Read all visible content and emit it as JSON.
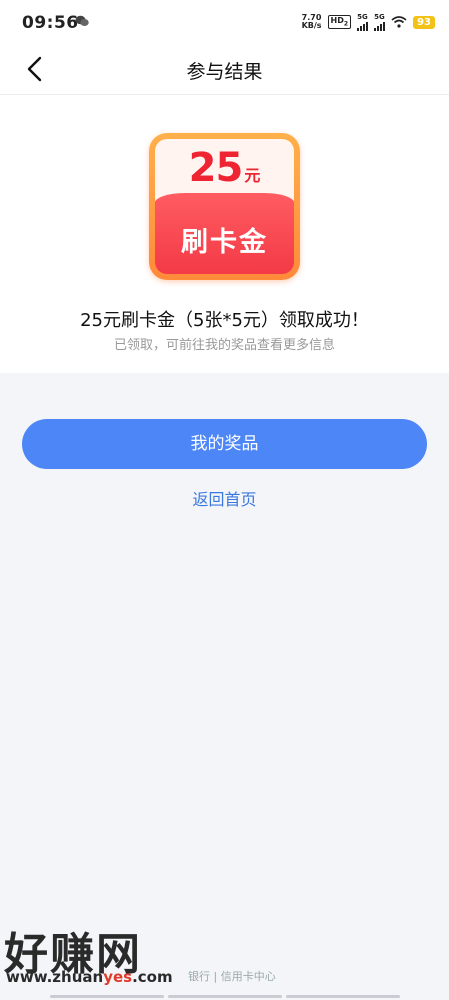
{
  "status_bar": {
    "time": "09:56",
    "net_speed_value": "7.70",
    "net_speed_unit": "KB/s",
    "hd_label": "HD",
    "sim2_label": "2",
    "signal1_label": "5G",
    "signal2_label": "5G",
    "battery": "93"
  },
  "header": {
    "title": "参与结果"
  },
  "prize": {
    "amount": "25",
    "amount_unit": "元",
    "label": "刷卡金",
    "result_title": "25元刷卡金（5张*5元）领取成功！",
    "result_subtitle": "已领取，可前往我的奖品查看更多信息"
  },
  "actions": {
    "my_prizes_label": "我的奖品",
    "back_home_label": "返回首页"
  },
  "footer": {
    "text": "银行 | 信用卡中心"
  },
  "watermark": {
    "big": "好赚网",
    "small_prefix": "www.zhuan",
    "small_highlight": "yes",
    "small_suffix": ".com"
  },
  "colors": {
    "primary_button": "#4d86f7",
    "link": "#3a78e0",
    "badge_red": "#f33a46",
    "badge_orange": "#ff8a3a",
    "battery": "#f2c316"
  }
}
